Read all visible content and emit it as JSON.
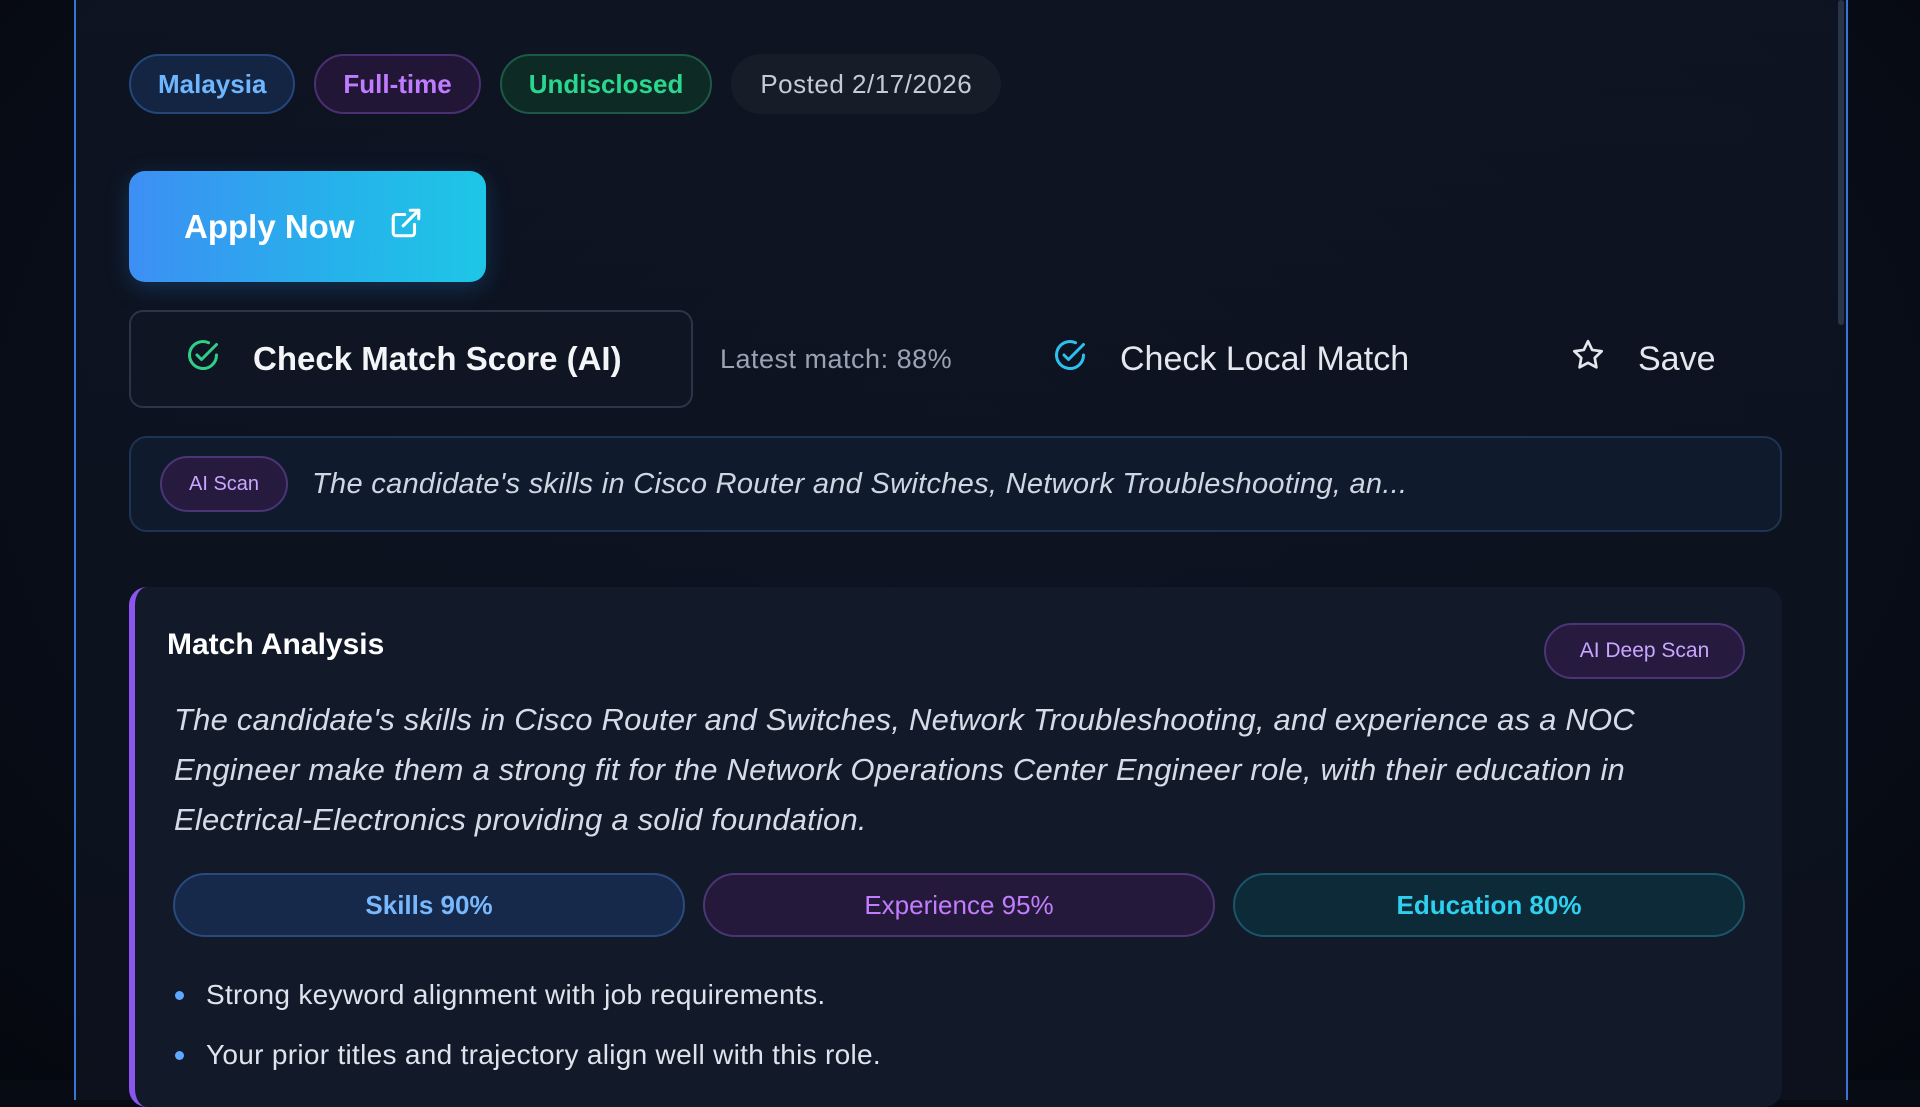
{
  "tags": {
    "country": "Malaysia",
    "employment_type": "Full-time",
    "salary": "Undisclosed",
    "posted": "Posted 2/17/2026"
  },
  "actions": {
    "apply_label": "Apply Now",
    "match_score_label": "Check Match Score (AI)",
    "latest_match": "Latest match: 88%",
    "local_match_label": "Check Local Match",
    "save_label": "Save"
  },
  "ai_scan": {
    "badge": "AI Scan",
    "text": "The candidate's skills in Cisco Router and Switches, Network Troubleshooting, an..."
  },
  "match_analysis": {
    "title": "Match Analysis",
    "badge": "AI Deep Scan",
    "summary": "The candidate's skills in Cisco Router and Switches, Network Troubleshooting, and experience as a NOC Engineer make them a strong fit for the Network Operations Center Engineer role, with their education in Electrical-Electronics providing a solid foundation.",
    "scores": {
      "skills": "Skills 90%",
      "experience": "Experience 95%",
      "education": "Education 80%"
    },
    "bullets": [
      "Strong keyword alignment with job requirements.",
      "Your prior titles and trajectory align well with this role."
    ]
  },
  "icons": {
    "apply": "external-link-icon",
    "match_score": "check-circle-icon",
    "local_match": "check-circle-icon",
    "save": "star-icon"
  },
  "colors": {
    "accent_blue": "#3d8ff4",
    "accent_cyan": "#1ec6e6",
    "accent_purple": "#8c55f0",
    "success_green": "#2bd68e"
  }
}
